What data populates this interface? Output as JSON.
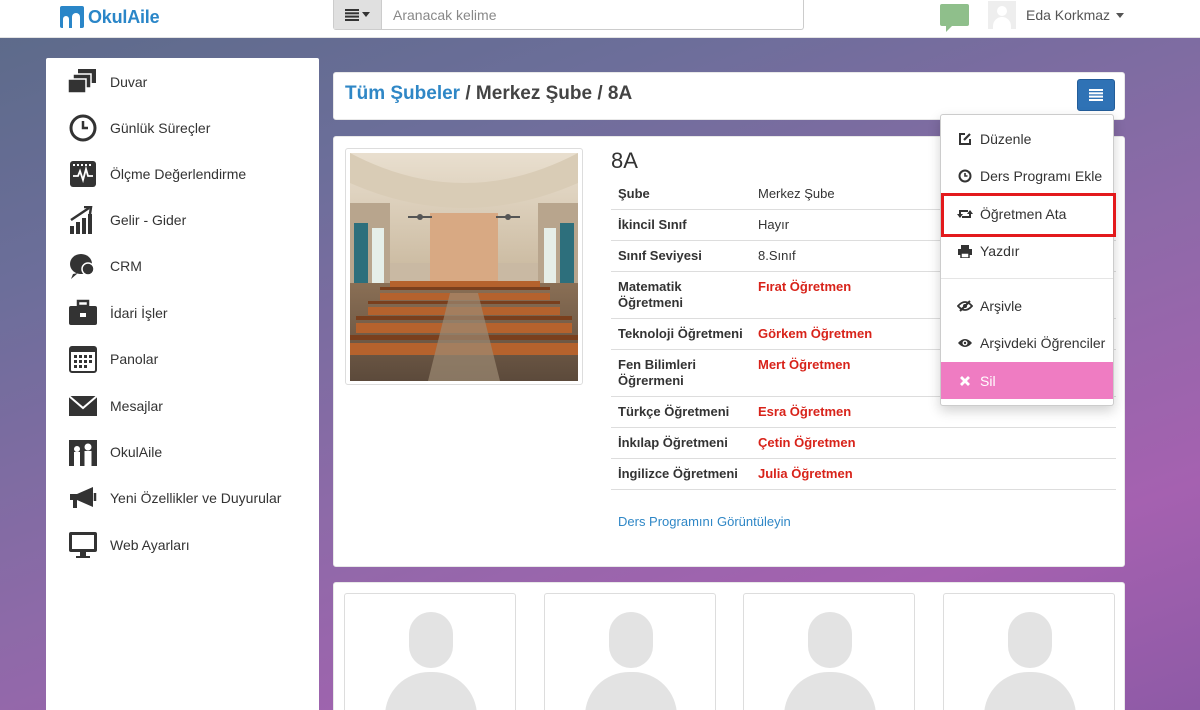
{
  "brand": {
    "name": "OkulAile"
  },
  "search": {
    "placeholder": "Aranacak kelime"
  },
  "user": {
    "name": "Eda Korkmaz"
  },
  "sidebar": {
    "items": [
      {
        "label": "Duvar",
        "icon": "wall-icon"
      },
      {
        "label": "Günlük Süreçler",
        "icon": "clock-icon"
      },
      {
        "label": "Ölçme Değerlendirme",
        "icon": "chart-pulse-icon"
      },
      {
        "label": "Gelir - Gider",
        "icon": "bar-growth-icon"
      },
      {
        "label": "CRM",
        "icon": "crm-icon"
      },
      {
        "label": "İdari İşler",
        "icon": "briefcase-icon"
      },
      {
        "label": "Panolar",
        "icon": "calendar-grid-icon"
      },
      {
        "label": "Mesajlar",
        "icon": "envelope-icon"
      },
      {
        "label": "OkulAile",
        "icon": "family-icon"
      },
      {
        "label": "Yeni Özellikler ve Duyurular",
        "icon": "megaphone-icon"
      },
      {
        "label": "Web Ayarları",
        "icon": "monitor-icon"
      }
    ]
  },
  "breadcrumb": {
    "root": "Tüm Şubeler",
    "sep1": " / ",
    "branch": "Merkez Şube",
    "sep2": " / ",
    "current": "8A"
  },
  "class": {
    "title": "8A",
    "rows": [
      {
        "label": "Şube",
        "value": "Merkez Şube",
        "teacher": false
      },
      {
        "label": "İkincil Sınıf",
        "value": "Hayır",
        "teacher": false
      },
      {
        "label": "Sınıf Seviyesi",
        "value": "8.Sınıf",
        "teacher": false
      },
      {
        "label": "Matematik Öğretmeni",
        "value": "Fırat Öğretmen",
        "teacher": true
      },
      {
        "label": "Teknoloji Öğretmeni",
        "value": "Görkem Öğretmen",
        "teacher": true
      },
      {
        "label": "Fen Bilimleri Öğrermeni",
        "value": "Mert Öğretmen",
        "teacher": true
      },
      {
        "label": "Türkçe Öğretmeni",
        "value": "Esra Öğretmen",
        "teacher": true
      },
      {
        "label": "İnkılap Öğretmeni",
        "value": "Çetin Öğretmen",
        "teacher": true
      },
      {
        "label": "İngilizce Öğretmeni",
        "value": "Julia Öğretmen",
        "teacher": true
      }
    ],
    "schedule_link": "Ders Programını Görüntüleyin"
  },
  "dropdown": {
    "items": [
      {
        "label": "Düzenle",
        "icon": "edit-icon"
      },
      {
        "label": "Ders Programı Ekle",
        "icon": "clock-icon"
      },
      {
        "label": "Öğretmen Ata",
        "icon": "retweet-icon"
      },
      {
        "label": "Yazdır",
        "icon": "print-icon"
      },
      {
        "label": "Arşivle",
        "icon": "eye-slash-icon"
      },
      {
        "label": "Arşivdeki Öğrenciler",
        "icon": "eye-icon"
      },
      {
        "label": "Sil",
        "icon": "x-icon"
      }
    ]
  },
  "colors": {
    "accent": "#2f87c6",
    "teacher": "#d8231a",
    "danger": "#ef7cc2",
    "highlight": "#e3191c"
  }
}
